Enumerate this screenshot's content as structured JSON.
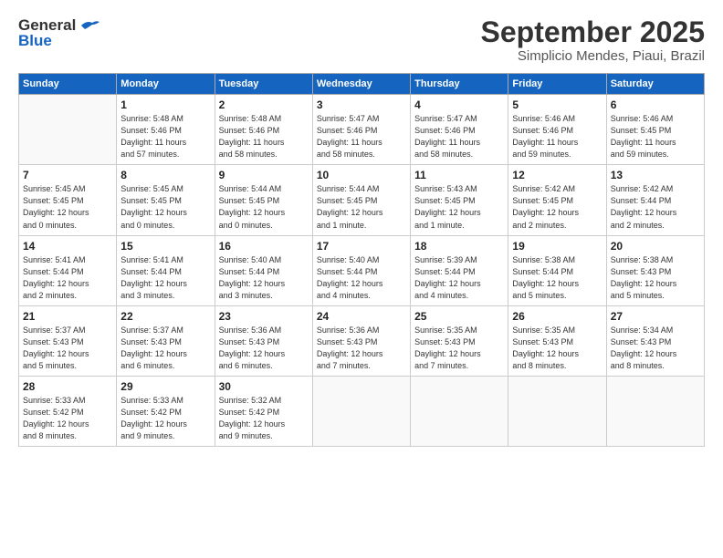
{
  "header": {
    "logo_line1": "General",
    "logo_line2": "Blue",
    "month": "September 2025",
    "location": "Simplicio Mendes, Piaui, Brazil"
  },
  "days_of_week": [
    "Sunday",
    "Monday",
    "Tuesday",
    "Wednesday",
    "Thursday",
    "Friday",
    "Saturday"
  ],
  "weeks": [
    [
      {
        "day": "",
        "info": ""
      },
      {
        "day": "1",
        "info": "Sunrise: 5:48 AM\nSunset: 5:46 PM\nDaylight: 11 hours\nand 57 minutes."
      },
      {
        "day": "2",
        "info": "Sunrise: 5:48 AM\nSunset: 5:46 PM\nDaylight: 11 hours\nand 58 minutes."
      },
      {
        "day": "3",
        "info": "Sunrise: 5:47 AM\nSunset: 5:46 PM\nDaylight: 11 hours\nand 58 minutes."
      },
      {
        "day": "4",
        "info": "Sunrise: 5:47 AM\nSunset: 5:46 PM\nDaylight: 11 hours\nand 58 minutes."
      },
      {
        "day": "5",
        "info": "Sunrise: 5:46 AM\nSunset: 5:46 PM\nDaylight: 11 hours\nand 59 minutes."
      },
      {
        "day": "6",
        "info": "Sunrise: 5:46 AM\nSunset: 5:45 PM\nDaylight: 11 hours\nand 59 minutes."
      }
    ],
    [
      {
        "day": "7",
        "info": "Sunrise: 5:45 AM\nSunset: 5:45 PM\nDaylight: 12 hours\nand 0 minutes."
      },
      {
        "day": "8",
        "info": "Sunrise: 5:45 AM\nSunset: 5:45 PM\nDaylight: 12 hours\nand 0 minutes."
      },
      {
        "day": "9",
        "info": "Sunrise: 5:44 AM\nSunset: 5:45 PM\nDaylight: 12 hours\nand 0 minutes."
      },
      {
        "day": "10",
        "info": "Sunrise: 5:44 AM\nSunset: 5:45 PM\nDaylight: 12 hours\nand 1 minute."
      },
      {
        "day": "11",
        "info": "Sunrise: 5:43 AM\nSunset: 5:45 PM\nDaylight: 12 hours\nand 1 minute."
      },
      {
        "day": "12",
        "info": "Sunrise: 5:42 AM\nSunset: 5:45 PM\nDaylight: 12 hours\nand 2 minutes."
      },
      {
        "day": "13",
        "info": "Sunrise: 5:42 AM\nSunset: 5:44 PM\nDaylight: 12 hours\nand 2 minutes."
      }
    ],
    [
      {
        "day": "14",
        "info": "Sunrise: 5:41 AM\nSunset: 5:44 PM\nDaylight: 12 hours\nand 2 minutes."
      },
      {
        "day": "15",
        "info": "Sunrise: 5:41 AM\nSunset: 5:44 PM\nDaylight: 12 hours\nand 3 minutes."
      },
      {
        "day": "16",
        "info": "Sunrise: 5:40 AM\nSunset: 5:44 PM\nDaylight: 12 hours\nand 3 minutes."
      },
      {
        "day": "17",
        "info": "Sunrise: 5:40 AM\nSunset: 5:44 PM\nDaylight: 12 hours\nand 4 minutes."
      },
      {
        "day": "18",
        "info": "Sunrise: 5:39 AM\nSunset: 5:44 PM\nDaylight: 12 hours\nand 4 minutes."
      },
      {
        "day": "19",
        "info": "Sunrise: 5:38 AM\nSunset: 5:44 PM\nDaylight: 12 hours\nand 5 minutes."
      },
      {
        "day": "20",
        "info": "Sunrise: 5:38 AM\nSunset: 5:43 PM\nDaylight: 12 hours\nand 5 minutes."
      }
    ],
    [
      {
        "day": "21",
        "info": "Sunrise: 5:37 AM\nSunset: 5:43 PM\nDaylight: 12 hours\nand 5 minutes."
      },
      {
        "day": "22",
        "info": "Sunrise: 5:37 AM\nSunset: 5:43 PM\nDaylight: 12 hours\nand 6 minutes."
      },
      {
        "day": "23",
        "info": "Sunrise: 5:36 AM\nSunset: 5:43 PM\nDaylight: 12 hours\nand 6 minutes."
      },
      {
        "day": "24",
        "info": "Sunrise: 5:36 AM\nSunset: 5:43 PM\nDaylight: 12 hours\nand 7 minutes."
      },
      {
        "day": "25",
        "info": "Sunrise: 5:35 AM\nSunset: 5:43 PM\nDaylight: 12 hours\nand 7 minutes."
      },
      {
        "day": "26",
        "info": "Sunrise: 5:35 AM\nSunset: 5:43 PM\nDaylight: 12 hours\nand 8 minutes."
      },
      {
        "day": "27",
        "info": "Sunrise: 5:34 AM\nSunset: 5:43 PM\nDaylight: 12 hours\nand 8 minutes."
      }
    ],
    [
      {
        "day": "28",
        "info": "Sunrise: 5:33 AM\nSunset: 5:42 PM\nDaylight: 12 hours\nand 8 minutes."
      },
      {
        "day": "29",
        "info": "Sunrise: 5:33 AM\nSunset: 5:42 PM\nDaylight: 12 hours\nand 9 minutes."
      },
      {
        "day": "30",
        "info": "Sunrise: 5:32 AM\nSunset: 5:42 PM\nDaylight: 12 hours\nand 9 minutes."
      },
      {
        "day": "",
        "info": ""
      },
      {
        "day": "",
        "info": ""
      },
      {
        "day": "",
        "info": ""
      },
      {
        "day": "",
        "info": ""
      }
    ]
  ]
}
